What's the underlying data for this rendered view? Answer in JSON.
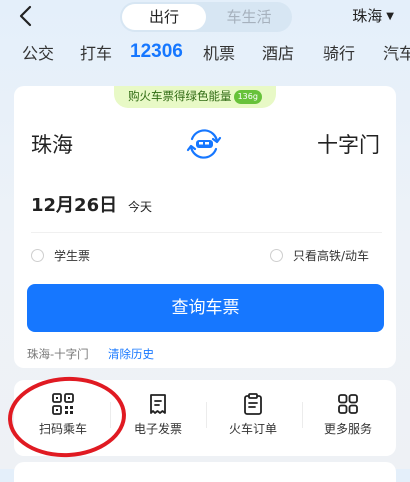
{
  "header": {
    "segments": [
      "出行",
      "车生活"
    ],
    "active_segment": 0,
    "city": "珠海"
  },
  "tabs": [
    {
      "label": "公交"
    },
    {
      "label": "打车"
    },
    {
      "label": "12306",
      "active": true
    },
    {
      "label": "机票"
    },
    {
      "label": "酒店"
    },
    {
      "label": "骑行"
    },
    {
      "label": "汽车"
    }
  ],
  "promo": {
    "text": "购火车票得绿色能量",
    "badge": "136g"
  },
  "trip": {
    "from": "珠海",
    "to": "十字门",
    "date": "12月26日",
    "date_note": "今天"
  },
  "options": {
    "student": "学生票",
    "high_speed": "只看高铁/动车"
  },
  "query_button": "查询车票",
  "history": {
    "item": "珠海-十字门",
    "clear": "清除历史"
  },
  "quick_actions": [
    {
      "label": "扫码乘车",
      "icon": "qr-scan-icon"
    },
    {
      "label": "电子发票",
      "icon": "receipt-icon"
    },
    {
      "label": "火车订单",
      "icon": "clipboard-icon"
    },
    {
      "label": "更多服务",
      "icon": "grid-icon"
    }
  ],
  "colors": {
    "accent": "#1677ff",
    "annotation": "#e01a22",
    "promo_bg": "#e8f9c6"
  }
}
